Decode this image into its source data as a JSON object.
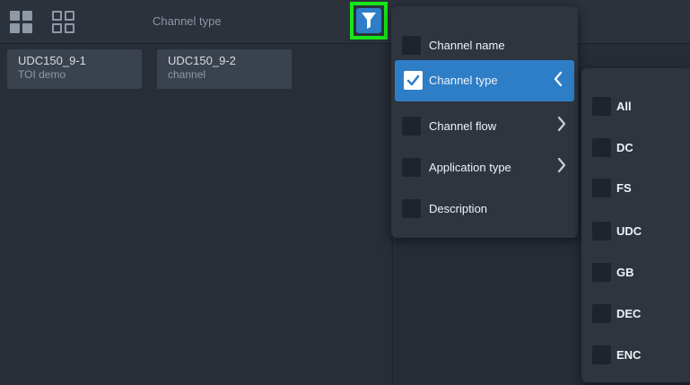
{
  "toolbar": {
    "filter_label": "Channel type"
  },
  "channels": [
    {
      "name": "UDC150_9-1",
      "sub": "TOI demo"
    },
    {
      "name": "UDC150_9-2",
      "sub": "channel"
    }
  ],
  "filter_menu": {
    "items": [
      {
        "label": "Channel name",
        "checked": false,
        "arrow": ""
      },
      {
        "label": "Channel type",
        "checked": true,
        "arrow": "left"
      },
      {
        "label": "Channel flow",
        "checked": false,
        "arrow": "right"
      },
      {
        "label": "Application type",
        "checked": false,
        "arrow": "right"
      },
      {
        "label": "Description",
        "checked": false,
        "arrow": ""
      }
    ]
  },
  "channel_type_submenu": {
    "options": [
      {
        "label": "All",
        "checked": false
      },
      {
        "label": "DC",
        "checked": false
      },
      {
        "label": "FS",
        "checked": false
      },
      {
        "label": "UDC",
        "checked": false
      },
      {
        "label": "GB",
        "checked": false
      },
      {
        "label": "DEC",
        "checked": false
      },
      {
        "label": "ENC",
        "checked": false
      }
    ]
  },
  "colors": {
    "accent": "#2e7ec7",
    "highlight_box": "#19e619",
    "background": "#232a33",
    "panel": "#2e353f"
  },
  "icons": {
    "grid_filled": "grid-view-icon",
    "grid_outline": "grid-outline-view-icon",
    "filter": "filter-funnel-icon",
    "check": "checkmark-icon",
    "chevron_left": "chevron-left-icon",
    "chevron_right": "chevron-right-icon"
  }
}
